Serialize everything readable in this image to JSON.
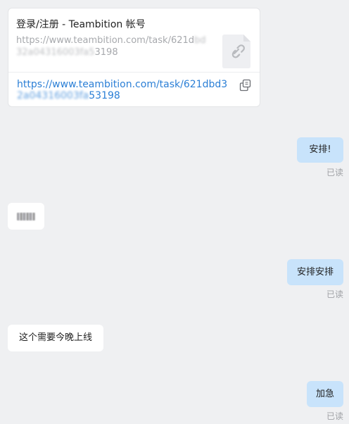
{
  "link_card": {
    "title": "登录/注册 - Teambition 帐号",
    "desc_visible": "https://www.teambition.com/task/621d",
    "desc_blurred": "bd32a04316003fa5",
    "desc_tail": "3198",
    "url_visible": "https://www.teambition.com/task/621dbd3",
    "url_blurred": "2a04316003fa",
    "url_tail": "53198",
    "thumb_icon": "link-icon",
    "copy_icon": "copy-icon"
  },
  "messages": [
    {
      "direction": "outgoing",
      "text": "安排!",
      "status": "已读"
    },
    {
      "direction": "incoming",
      "text": "",
      "redacted": true
    },
    {
      "direction": "outgoing",
      "text": "安排安排",
      "status": "已读"
    },
    {
      "direction": "incoming",
      "text": "这个需要今晚上线"
    },
    {
      "direction": "outgoing",
      "text": "加急",
      "status": "已读"
    }
  ],
  "colors": {
    "background": "#eff0f2",
    "outgoing_bubble": "#c8e3fb",
    "incoming_bubble": "#ffffff",
    "link": "#2b7fd6"
  }
}
